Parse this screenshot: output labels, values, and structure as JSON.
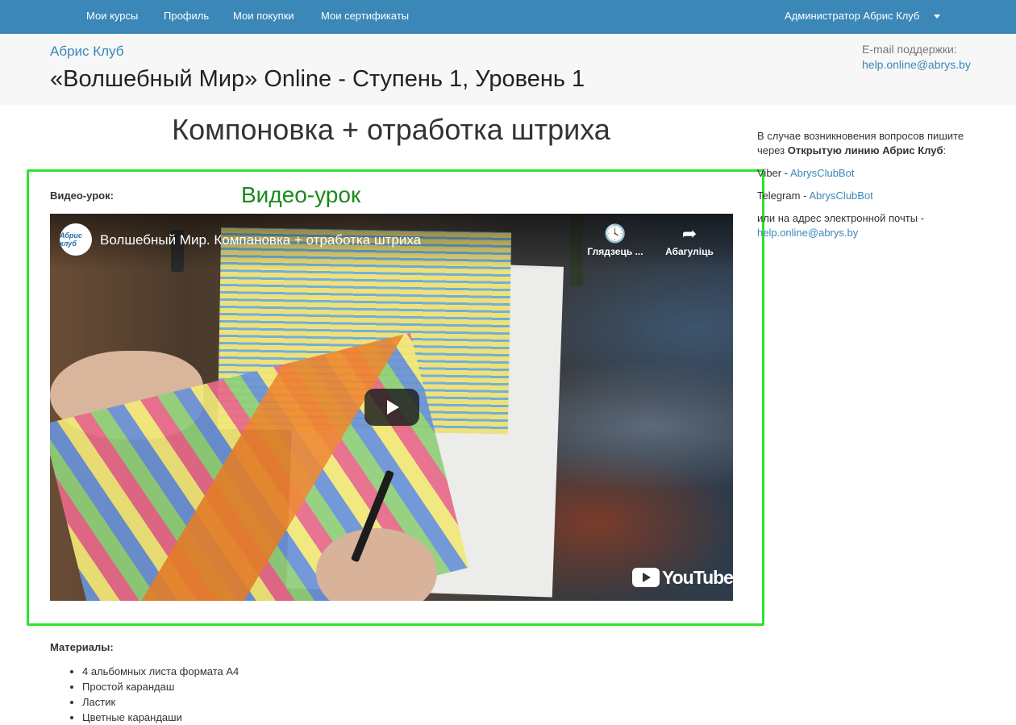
{
  "nav": {
    "items": [
      {
        "label": "Мои курсы"
      },
      {
        "label": "Профиль"
      },
      {
        "label": "Мои покупки"
      },
      {
        "label": "Мои сертификаты"
      }
    ],
    "user": "Администратор Абрис Клуб"
  },
  "header": {
    "brand": "Абрис Клуб",
    "course_title": "«Волшебный Мир» Online - Ступень 1, Уровень 1",
    "support_label": "E-mail поддержки:",
    "support_email": "help.online@abrys.by"
  },
  "lesson": {
    "title": "Компоновка + отработка штриха",
    "video_label": "Видео-урок:",
    "highlight_label": "Видео-урок"
  },
  "video": {
    "channel_avatar_text": "Абрис клуб",
    "title": "Волшебный Мир. Компановка + отработка штриха",
    "watch_later": "Глядзець ...",
    "share": "Абагуліць",
    "logo_text": "YouTube"
  },
  "sidebar": {
    "intro_text": "В случае возникновения вопросов пишите через ",
    "intro_bold": "Открытую линию Абрис Клуб",
    "intro_end": ":",
    "viber_label": "Viber - ",
    "viber_link": "AbrysClubBot",
    "telegram_label": "Telegram - ",
    "telegram_link": "AbrysClubBot",
    "email_text": "или на адрес электронной почты - ",
    "email_link": "help.online@abrys.by"
  },
  "materials": {
    "label": "Материалы:",
    "items": [
      "4 альбомных листа формата А4",
      "Простой карандаш",
      "Ластик",
      "Цветные карандаши"
    ]
  },
  "colors": {
    "nav_bg": "#3a87b8",
    "link": "#3a87b8",
    "highlight": "#2ee22e",
    "highlight_text": "#1a8a1a"
  }
}
